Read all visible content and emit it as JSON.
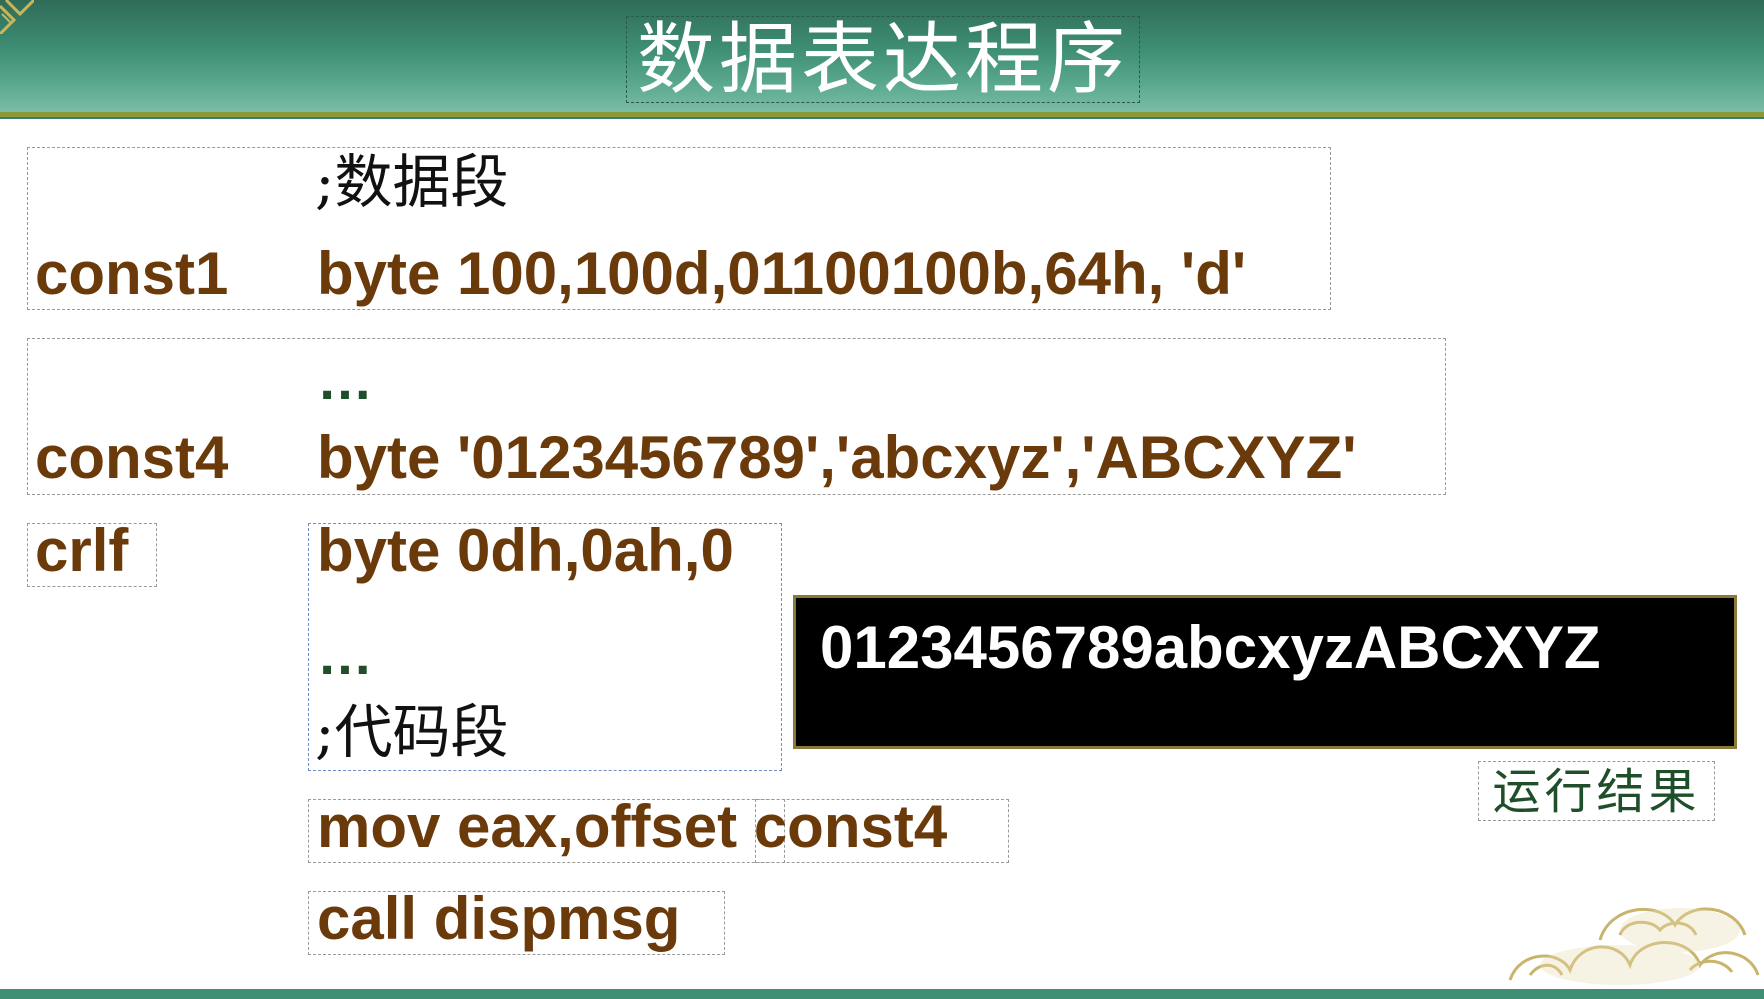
{
  "slide": {
    "title": "数据表达程序"
  },
  "code": {
    "data_comment": ";数据段",
    "const1_label": "const1",
    "const1_value": "byte 100,100d,01100100b,64h, 'd'",
    "ellipsis1": "…",
    "const4_label": "const4",
    "const4_value": "byte '0123456789','abcxyz','ABCXYZ'",
    "crlf_label": "crlf",
    "crlf_value": "byte 0dh,0ah,0",
    "ellipsis2": "…",
    "code_comment": ";代码段",
    "mov_line": "mov eax,offset const4",
    "call_line": "call dispmsg"
  },
  "console": {
    "output": "0123456789abcxyzABCXYZ"
  },
  "result": {
    "label": "运行结果"
  },
  "colors": {
    "header_green": "#3f8f75",
    "code_brown": "#6b3a0a",
    "console_bg": "#000000",
    "label_green": "#1f4f2a"
  },
  "icons": {
    "corner": "corner-ornament-icon",
    "cloud": "cloud-ornament-icon"
  }
}
